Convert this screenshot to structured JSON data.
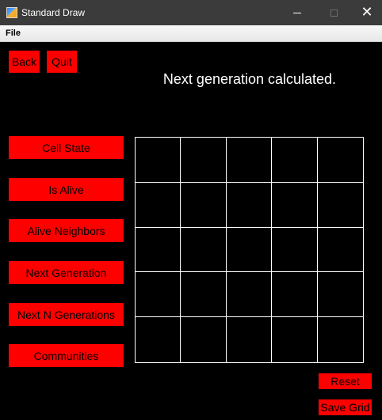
{
  "window": {
    "title": "Standard Draw",
    "controls": {
      "minimize_icon": "minimize-icon",
      "maximize_icon": "maximize-icon",
      "close_icon": "close-icon",
      "close_glyph": "✕"
    }
  },
  "menu": {
    "items": [
      "File"
    ]
  },
  "toolbar": {
    "back_label": "Back",
    "quit_label": "Quit"
  },
  "status": {
    "message": "Next generation calculated."
  },
  "actions": [
    "Cell State",
    "Is Alive",
    "Alive Neighbors",
    "Next Generation",
    "Next N Generations",
    "Communities"
  ],
  "grid": {
    "rows": 5,
    "columns": 5,
    "alive_cells": []
  },
  "footer": {
    "reset_label": "Reset",
    "save_grid_label": "Save Grid"
  },
  "colors": {
    "canvas_background": "#000000",
    "button_background": "#ff0000",
    "button_text": "#000000",
    "grid_lines": "#ffffff",
    "status_text": "#ffffff",
    "title_bar": "#3b3b3b"
  }
}
